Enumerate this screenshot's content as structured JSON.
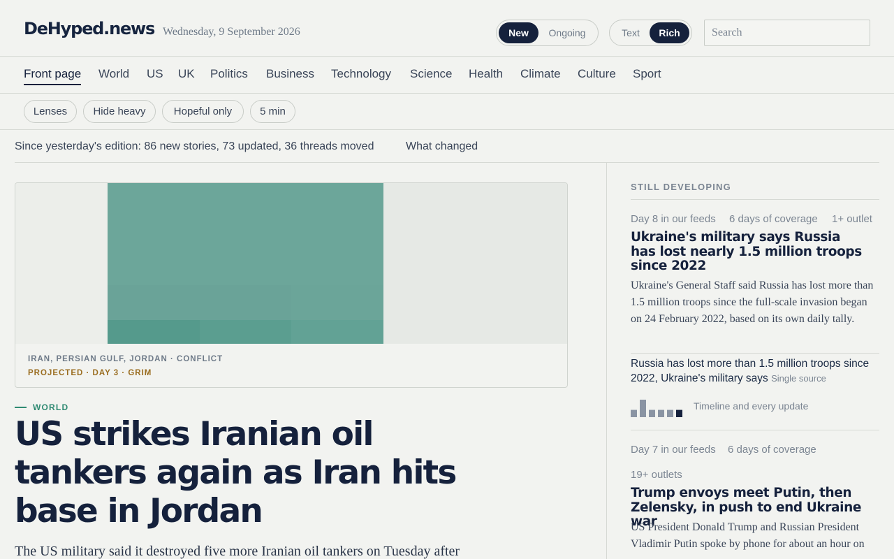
{
  "header": {
    "logo": "DeHyped.news",
    "date": "Wednesday, 9 September 2026",
    "view_toggle": {
      "options": [
        "New",
        "Ongoing"
      ],
      "selected": "New"
    },
    "mode_toggle": {
      "options": [
        "Text",
        "Rich"
      ],
      "selected": "Rich"
    },
    "search_placeholder": "Search"
  },
  "nav": {
    "items": [
      "Front page",
      "World",
      "US",
      "UK",
      "Politics",
      "Business",
      "Technology",
      "Science",
      "Health",
      "Climate",
      "Culture",
      "Sport"
    ],
    "active": "Front page"
  },
  "filters": [
    "Lenses",
    "Hide heavy",
    "Hopeful only",
    "5 min"
  ],
  "changes": {
    "summary": "Since yesterday's edition: 86 new stories, 73 updated, 36 threads moved",
    "link": "What changed"
  },
  "lead": {
    "card_tags": "IRAN, PERSIAN GULF, JORDAN · CONFLICT",
    "card_status": "PROJECTED · DAY 3 · GRIM",
    "kicker": "WORLD",
    "headline": "US strikes Iranian oil tankers again as Iran hits base in Jordan",
    "dek": "The US military said it destroyed five more Iranian oil tankers on Tuesday after",
    "colors": {
      "image_main": "#6ca69a",
      "image_dark": "#559a8c",
      "kicker": "#2f8a72",
      "status": "#9a6d20"
    }
  },
  "sidebar": {
    "label": "STILL DEVELOPING",
    "stories": [
      {
        "meta": [
          "Day 8 in our feeds",
          "6 days of coverage",
          "1+ outlet"
        ],
        "title": "Ukraine's military says Russia has lost nearly 1.5 million troops since 2022",
        "body": "Ukraine's General Staff said Russia has lost more than 1.5 million troops since the full-scale invasion began on 24 February 2022, based on its own daily tally.",
        "related_title": "Russia has lost more than 1.5 million troops since 2022, Ukraine's military says",
        "related_source": "Single source",
        "timeline_link": "Timeline and every update",
        "timeline_counts": [
          1,
          2.4,
          1,
          1,
          1,
          1
        ]
      },
      {
        "meta": [
          "Day 7 in our feeds",
          "6 days of coverage"
        ],
        "outlets": "19+ outlets",
        "title": "Trump envoys meet Putin, then Zelensky, in push to end Ukraine war",
        "body": "US President Donald Trump and Russian President Vladimir Putin spoke by phone for about an hour on"
      }
    ]
  }
}
